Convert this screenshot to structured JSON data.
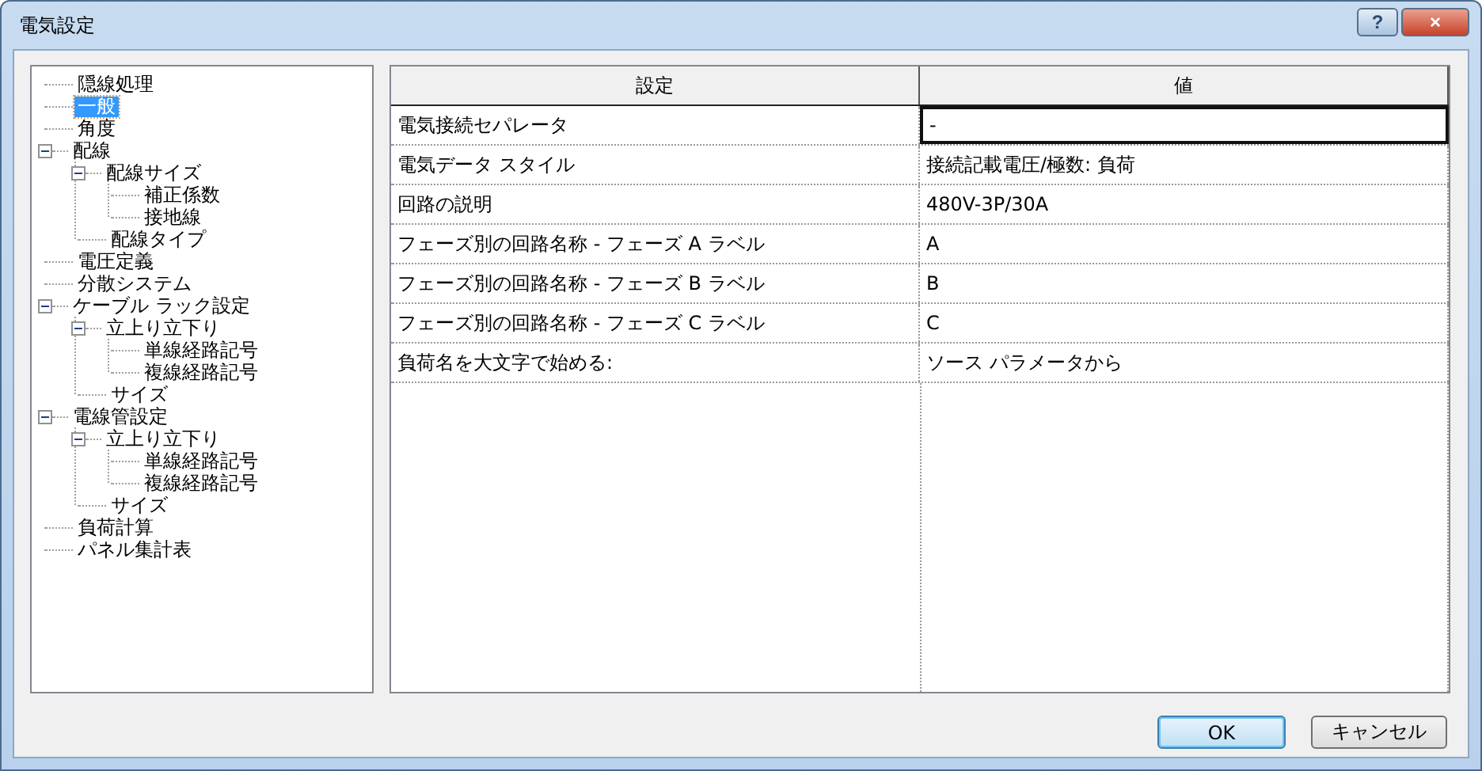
{
  "window": {
    "title": "電気設定",
    "buttons": [
      {
        "kind": "help",
        "label": "?"
      },
      {
        "kind": "close",
        "label": "×"
      }
    ]
  },
  "tree": [
    {
      "label": "隠線処理",
      "selected": false
    },
    {
      "label": "一般",
      "selected": true
    },
    {
      "label": "角度",
      "selected": false
    },
    {
      "label": "配線",
      "selected": false,
      "expanded": true,
      "children": [
        {
          "label": "配線サイズ",
          "selected": false,
          "expanded": true,
          "children": [
            {
              "label": "補正係数",
              "selected": false
            },
            {
              "label": "接地線",
              "selected": false
            }
          ]
        },
        {
          "label": "配線タイプ",
          "selected": false
        }
      ]
    },
    {
      "label": "電圧定義",
      "selected": false
    },
    {
      "label": "分散システム",
      "selected": false
    },
    {
      "label": "ケーブル ラック設定",
      "selected": false,
      "expanded": true,
      "children": [
        {
          "label": "立上り立下り",
          "selected": false,
          "expanded": true,
          "children": [
            {
              "label": "単線経路記号",
              "selected": false
            },
            {
              "label": "複線経路記号",
              "selected": false
            }
          ]
        },
        {
          "label": "サイズ",
          "selected": false
        }
      ]
    },
    {
      "label": "電線管設定",
      "selected": false,
      "expanded": true,
      "children": [
        {
          "label": "立上り立下り",
          "selected": false,
          "expanded": true,
          "children": [
            {
              "label": "単線経路記号",
              "selected": false
            },
            {
              "label": "複線経路記号",
              "selected": false
            }
          ]
        },
        {
          "label": "サイズ",
          "selected": false
        }
      ]
    },
    {
      "label": "負荷計算",
      "selected": false
    },
    {
      "label": "パネル集計表",
      "selected": false
    }
  ],
  "table": {
    "columns": [
      "設定",
      "値"
    ],
    "rows": [
      {
        "setting": "電気接続セパレータ",
        "value": "-",
        "selected": true
      },
      {
        "setting": "電気データ スタイル",
        "value": "接続記載電圧/極数: 負荷",
        "selected": false
      },
      {
        "setting": "回路の説明",
        "value": "480V-3P/30A",
        "selected": false
      },
      {
        "setting": "フェーズ別の回路名称 - フェーズ A ラベル",
        "value": "A",
        "selected": false
      },
      {
        "setting": "フェーズ別の回路名称 - フェーズ B ラベル",
        "value": "B",
        "selected": false
      },
      {
        "setting": "フェーズ別の回路名称 - フェーズ C ラベル",
        "value": "C",
        "selected": false
      },
      {
        "setting": "負荷名を大文字で始める:",
        "value": "ソース パラメータから",
        "selected": false
      }
    ]
  },
  "buttons": [
    {
      "label": "OK",
      "default": true
    },
    {
      "label": "キャンセル",
      "default": false
    }
  ]
}
